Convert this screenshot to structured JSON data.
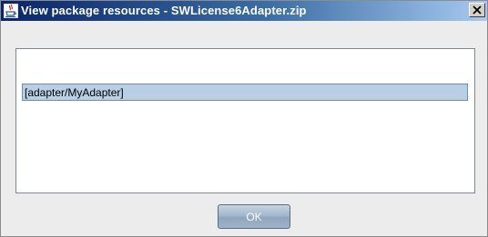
{
  "window": {
    "title": "View package resources - SWLicense6Adapter.zip",
    "icon": "java-coffee-icon",
    "close_icon": "close-icon",
    "close_label": "×"
  },
  "resources": {
    "items": [
      {
        "label": "[adapter/MyAdapter]",
        "selected": true
      }
    ]
  },
  "buttons": {
    "ok_label": "OK"
  },
  "colors": {
    "titlebar_start": "#0a246a",
    "titlebar_end": "#a6caf0",
    "selection_fill": "#b8cfe5",
    "dialog_bg": "#ececec"
  }
}
